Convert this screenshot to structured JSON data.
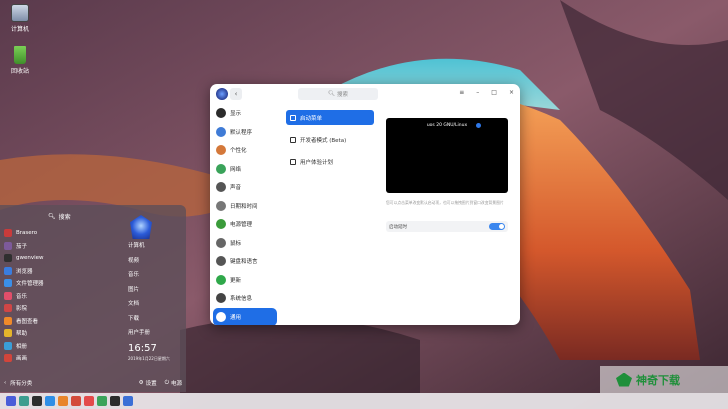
{
  "desktop": {
    "icons": [
      {
        "label": "计算机",
        "icon": "computer-icon"
      },
      {
        "label": "回收站",
        "icon": "trash-icon"
      }
    ]
  },
  "launcher": {
    "search_label": "搜索",
    "apps": [
      {
        "label": "Brasero",
        "color": "#c93b3b"
      },
      {
        "label": "茄子",
        "color": "#7d5a9b"
      },
      {
        "label": "gwenview",
        "color": "#2f2f2f"
      },
      {
        "label": "浏览器",
        "color": "#3a7de0"
      },
      {
        "label": "文件管理器",
        "color": "#3b8fe8"
      },
      {
        "label": "音乐",
        "color": "#e24e6a"
      },
      {
        "label": "影院",
        "color": "#d04646"
      },
      {
        "label": "看图查看",
        "color": "#f08a2a"
      },
      {
        "label": "帮助",
        "color": "#e5b52b"
      },
      {
        "label": "相册",
        "color": "#3a9ed8"
      },
      {
        "label": "画画",
        "color": "#d2453b"
      }
    ],
    "right_links": [
      "计算机",
      "视频",
      "音乐",
      "图片",
      "文档",
      "下载",
      "用户手册"
    ],
    "clock": "16:57",
    "date": "2019年1月22日星期六",
    "all_categories": "所有分类",
    "settings_label": "设置",
    "power_label": "电源"
  },
  "window": {
    "search_placeholder": "搜索",
    "controls": [
      "≡",
      "–",
      "□",
      "×"
    ],
    "sidebar": [
      {
        "label": "显示",
        "color": "#2b2b2b"
      },
      {
        "label": "默认程序",
        "color": "#3f7bd6"
      },
      {
        "label": "个性化",
        "color": "#d4783a"
      },
      {
        "label": "网络",
        "color": "#3aa35a"
      },
      {
        "label": "声音",
        "color": "#555555"
      },
      {
        "label": "日期和时间",
        "color": "#777777"
      },
      {
        "label": "电源管理",
        "color": "#3a9b3a"
      },
      {
        "label": "鼠标",
        "color": "#666666"
      },
      {
        "label": "键盘和语言",
        "color": "#555555"
      },
      {
        "label": "更新",
        "color": "#2fa84a"
      },
      {
        "label": "系统信息",
        "color": "#444444"
      },
      {
        "label": "通用",
        "color": "#1f6ee6",
        "active": true
      }
    ],
    "subnav": [
      {
        "label": "启动菜单",
        "active": true
      },
      {
        "label": "开发者模式 (Beta)",
        "active": false
      },
      {
        "label": "用户体验计划",
        "active": false
      }
    ],
    "preview_label": "uos 20 GNU/Linux",
    "preview_note": "您可以点击菜单改变默认启动项，也可以拖拽图片到窗口改变背景图片",
    "toggle_label": "启动延时",
    "toggle_on": true
  },
  "taskbar": {
    "icons": [
      {
        "name": "launcher-icon",
        "color": "#4a5dd8"
      },
      {
        "name": "multitask-icon",
        "color": "#3b9d8f"
      },
      {
        "name": "terminal-icon",
        "color": "#2d2d2d"
      },
      {
        "name": "file-manager-icon",
        "color": "#2f8ee6"
      },
      {
        "name": "browser-icon",
        "color": "#e8852b"
      },
      {
        "name": "mail-icon",
        "color": "#d34b3b"
      },
      {
        "name": "calendar-icon",
        "color": "#e34a4a"
      },
      {
        "name": "music-icon",
        "color": "#3aa35a"
      },
      {
        "name": "store-icon",
        "color": "#2c2c2c"
      },
      {
        "name": "settings-icon",
        "color": "#3b6fd6"
      }
    ]
  },
  "watermark": {
    "text": "神奇下载"
  }
}
